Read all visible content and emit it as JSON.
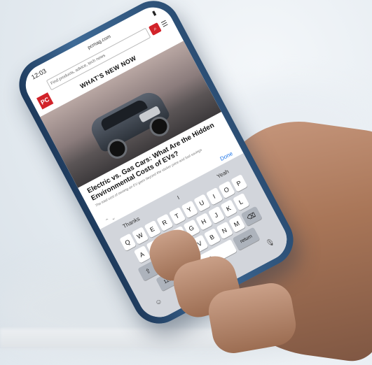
{
  "phone": {
    "status_time": "12:03",
    "status_url": "pcmag.com",
    "search_placeholder": "Find products, advice, tech news",
    "search_icon": "search-icon",
    "menu_icon": "hamburger-icon",
    "logo_text": "PC",
    "section_title": "WHAT'S NEW NOW",
    "headline": "Electric vs. Gas Cars: What Are the Hidden Environmental Costs of EVs?",
    "subtext": "The total cost of owning an EV goes beyond the sticker price and fuel savings",
    "done_label": "Done",
    "toolbar_chevrons": "⌃ ⌄"
  },
  "keyboard": {
    "suggestions": [
      "Thanks",
      "I",
      "Yeah"
    ],
    "row1": [
      "Q",
      "W",
      "E",
      "R",
      "T",
      "Y",
      "U",
      "I",
      "O",
      "P"
    ],
    "row2": [
      "A",
      "S",
      "D",
      "F",
      "G",
      "H",
      "J",
      "K",
      "L"
    ],
    "row3": [
      "⇧",
      "Z",
      "X",
      "C",
      "V",
      "B",
      "N",
      "M",
      "⌫"
    ],
    "row4": {
      "num": "123",
      "space": "space",
      "return": "return"
    },
    "emoji_icon": "☺",
    "mic_icon": "🎙"
  },
  "colors": {
    "brand": "#d2232a",
    "phone_frame": "#2b4e74",
    "link": "#1a73e8"
  }
}
